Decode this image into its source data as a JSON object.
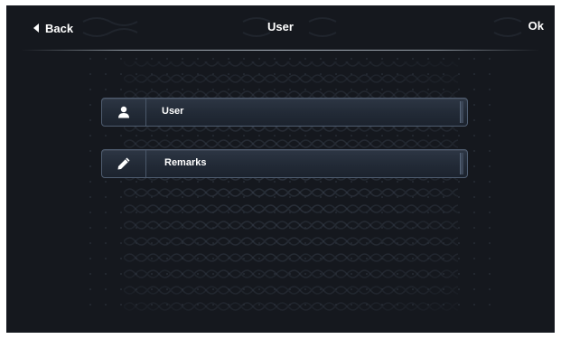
{
  "header": {
    "back_label": "Back",
    "title": "User",
    "ok_label": "Ok"
  },
  "fields": [
    {
      "label": "User",
      "icon": "person-icon"
    },
    {
      "label": "Remarks",
      "icon": "pencil-icon"
    }
  ],
  "colors": {
    "background": "#15181e",
    "field_border": "#4f5d70",
    "text": "#ffffff"
  }
}
